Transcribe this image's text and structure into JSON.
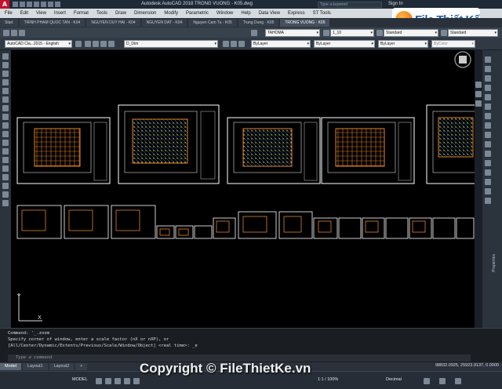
{
  "titlebar": {
    "app_icon": "A",
    "title": "Autodesk AutoCAD 2018    TRONG VUONG - K05.dwg",
    "search_placeholder": "Type a keyword",
    "sign_in": "Sign In"
  },
  "menu": [
    "File",
    "Edit",
    "View",
    "Insert",
    "Format",
    "Tools",
    "Draw",
    "Dimension",
    "Modify",
    "Parametric",
    "Window",
    "Help",
    "Data View",
    "Express",
    "ST Tools"
  ],
  "logo": {
    "text": "File Thiết Kế",
    "icon": "logo-circle"
  },
  "file_tabs": [
    "Start",
    "TRINH PHAM QUOC TAN - K04",
    "NGUYEN DUY HAI - K04",
    "NGUYEN DAT - K04",
    "Nguyen Cam Tu - K05",
    "Trung Dung - K05",
    "TRONG VUONG - K05"
  ],
  "style_toolbar": {
    "text_style": "TAHOMA",
    "dim_scale": "1_10",
    "dim_style": "Standard",
    "table_style": "Standard"
  },
  "layer_toolbar": {
    "workspace": "AutoCAD Cla...2015 - English",
    "layer": "D_Dim",
    "color": "ByLayer",
    "linetype": "ByLayer",
    "lineweight": "ByLayer",
    "plot_style": "ByColor"
  },
  "command": {
    "lines": [
      "Command: '_.zoom",
      "Specify corner of window, enter a scale factor (nX or nXP), or",
      "[All/Center/Dynamic/Extents/Previous/Scale/Window/Object] <real time>: _e"
    ],
    "input_placeholder": "Type a command"
  },
  "layout_tabs": [
    "Model",
    "Layout1",
    "Layout2",
    "+"
  ],
  "coordinates": "98832.0925, 25923.9137, 0.0000",
  "status": {
    "model": "MODEL",
    "scale": "1:1 / 100%",
    "units": "Decimal"
  },
  "right_palette_label": "Properties",
  "ucs": {
    "y_label": "Y",
    "x_label": "X"
  },
  "watermark": "Copyright © FileThietKe.vn",
  "colors": {
    "canvas": "#000000",
    "sheet_border": "#ffffff",
    "drawing_orange": "#e0822a"
  }
}
